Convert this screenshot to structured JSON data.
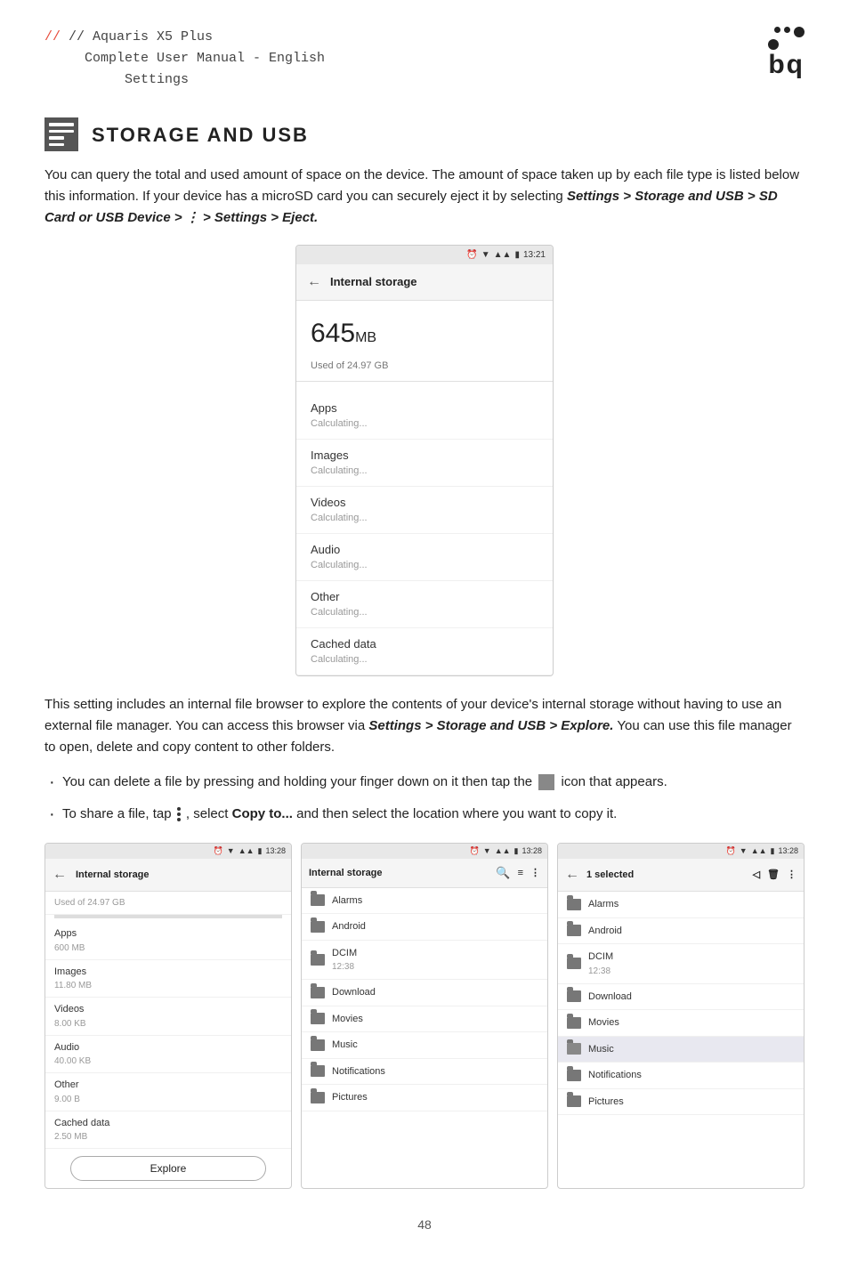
{
  "header": {
    "line1": "// Aquaris X5 Plus",
    "line2": "Complete User Manual - English",
    "line3": "Settings"
  },
  "section": {
    "title": "STORAGE AND USB",
    "intro": "You can query the total and used amount of space on the device. The amount of space taken up by each file type is listed below this information. If your device has a microSD card you can securely eject it by selecting ",
    "intro_bold": "Settings > Storage and USB > SD Card or USB Device > ⋮ > Settings > Eject.",
    "phone1": {
      "time": "13:21",
      "title": "Internal storage",
      "storage_size": "645",
      "storage_unit": "MB",
      "storage_sub": "Used of 24.97 GB",
      "rows": [
        {
          "label": "Apps",
          "sub": "Calculating..."
        },
        {
          "label": "Images",
          "sub": "Calculating..."
        },
        {
          "label": "Videos",
          "sub": "Calculating..."
        },
        {
          "label": "Audio",
          "sub": "Calculating..."
        },
        {
          "label": "Other",
          "sub": "Calculating..."
        },
        {
          "label": "Cached data",
          "sub": "Calculating..."
        }
      ]
    },
    "text2_before": "This setting includes an internal file browser to explore the contents of your device's internal storage without having to use an external file manager. You can access this browser via ",
    "text2_bold": "Settings > Storage and USB > Explore.",
    "text2_after": " You can use this file manager to open, delete and copy content to other folders.",
    "bullet1_before": "You can delete a file by pressing and holding your finger down on it then tap the ",
    "bullet1_after": " icon that appears.",
    "bullet2_before": "To share a file, tap ",
    "bullet2_middle": ", select ",
    "bullet2_bold": "Copy to...",
    "bullet2_after": " and then select the location where you want to copy it.",
    "phone2": {
      "time": "13:28",
      "title": "Internal storage",
      "sub": "Used of 24.97 GB",
      "rows": [
        {
          "label": "Apps",
          "sub": "600 MB"
        },
        {
          "label": "Images",
          "sub": "11.80 MB"
        },
        {
          "label": "Videos",
          "sub": "8.00 KB"
        },
        {
          "label": "Audio",
          "sub": "40.00 KB"
        },
        {
          "label": "Other",
          "sub": "9.00 B"
        },
        {
          "label": "Cached data",
          "sub": "2.50 MB"
        }
      ],
      "explore_label": "Explore"
    },
    "phone3": {
      "time": "13:28",
      "title": "Internal storage",
      "folders": [
        "Alarms",
        "Android",
        "DCIM",
        "Download",
        "Movies",
        "Music",
        "Notifications",
        "Pictures"
      ],
      "folder_sub": "12:38"
    },
    "phone4": {
      "time": "13:28",
      "title": "1 selected",
      "folders": [
        "Alarms",
        "Android",
        "DCIM",
        "Download",
        "Movies",
        "Music",
        "Notifications",
        "Pictures"
      ],
      "folder_sub": "12:38"
    }
  },
  "page_number": "48"
}
